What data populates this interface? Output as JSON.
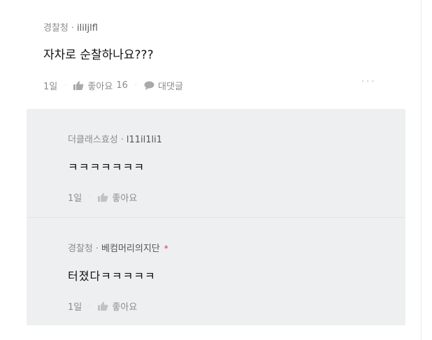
{
  "comment": {
    "channel": "경찰청",
    "separator": "·",
    "nickname": "ilil​jlfl",
    "text": "자차로 순찰하나요???",
    "time": "1일",
    "like_label": "좋아요",
    "like_count": "16",
    "reply_label": "대댓글",
    "more": "···"
  },
  "replies": [
    {
      "channel": "더클래스효성",
      "separator": "·",
      "nickname": "l11il1li1",
      "text": "ㅋㅋㅋㅋㅋㅋㅋ",
      "time": "1일",
      "like_label": "좋아요"
    },
    {
      "channel": "경찰청",
      "separator": "·",
      "nickname": "베컴머리의지단",
      "author_mark": "*",
      "text": "터졌다ㅋㅋㅋㅋㅋ",
      "time": "1일",
      "like_label": "좋아요"
    }
  ],
  "colors": {
    "reply_background": "#eeeff1",
    "author_mark": "#d23a4f",
    "muted_text": "#8c8c8c"
  },
  "icons": {
    "like": "thumbs-up-icon",
    "reply": "speech-bubble-icon",
    "more": "more-dots-icon"
  }
}
